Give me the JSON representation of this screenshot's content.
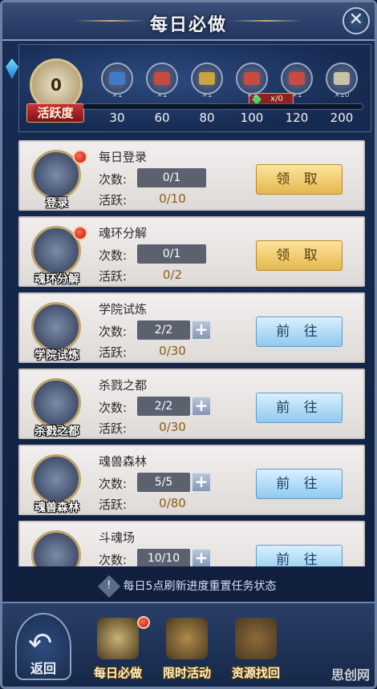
{
  "header": {
    "title": "每日必做",
    "close_icon": "close-icon"
  },
  "activity": {
    "current": "0",
    "label": "活跃度",
    "bonus_tag": "x/0",
    "progress_fraction": 0,
    "milestones": [
      {
        "value": "30",
        "qty": "×1",
        "color": "#3f7bc9"
      },
      {
        "value": "60",
        "qty": "×1",
        "color": "#c94b3f"
      },
      {
        "value": "80",
        "qty": "×1",
        "color": "#c9a43f"
      },
      {
        "value": "100",
        "qty": "×1",
        "color": "#c94b3f"
      },
      {
        "value": "120",
        "qty": "×1",
        "color": "#c94b3f"
      },
      {
        "value": "200",
        "qty": "×10",
        "color": "#c9c2a8"
      }
    ]
  },
  "tasks": [
    {
      "name": "每日登录",
      "icon_label": "登录",
      "count_label": "次数:",
      "count": "0/1",
      "active_label": "活跃:",
      "active": "0/10",
      "button": "领 取",
      "button_type": "claim",
      "has_plus": false,
      "has_dot": true,
      "icon": "scroll-icon"
    },
    {
      "name": "魂环分解",
      "icon_label": "魂环分解",
      "count_label": "次数:",
      "count": "0/1",
      "active_label": "活跃:",
      "active": "0/2",
      "button": "领 取",
      "button_type": "claim",
      "has_plus": false,
      "has_dot": true,
      "icon": "soul-ring-icon"
    },
    {
      "name": "学院试炼",
      "icon_label": "学院试炼",
      "count_label": "次数:",
      "count": "2/2",
      "active_label": "活跃:",
      "active": "0/30",
      "button": "前 往",
      "button_type": "go",
      "has_plus": true,
      "has_dot": false,
      "icon": "academy-icon"
    },
    {
      "name": "杀戮之都",
      "icon_label": "杀戮之都",
      "count_label": "次数:",
      "count": "2/2",
      "active_label": "活跃:",
      "active": "0/30",
      "button": "前 往",
      "button_type": "go",
      "has_plus": true,
      "has_dot": false,
      "icon": "goblet-icon"
    },
    {
      "name": "魂兽森林",
      "icon_label": "魂兽森林",
      "count_label": "次数:",
      "count": "5/5",
      "active_label": "活跃:",
      "active": "0/80",
      "button": "前 往",
      "button_type": "go",
      "has_plus": true,
      "has_dot": false,
      "icon": "beast-icon"
    },
    {
      "name": "斗魂场",
      "icon_label": "",
      "count_label": "次数:",
      "count": "10/10",
      "active_label": "活跃:",
      "active": "",
      "button": "前 往",
      "button_type": "go",
      "has_plus": true,
      "has_dot": false,
      "icon": "arena-icon"
    }
  ],
  "hint": {
    "icon": "exclamation-icon",
    "text": "每日5点刷新进度重置任务状态"
  },
  "bottom_nav": {
    "back_label": "返回",
    "tabs": [
      {
        "label": "每日必做",
        "icon": "quill-book-icon",
        "dot": true
      },
      {
        "label": "限时活动",
        "icon": "clock-book-icon",
        "dot": false
      },
      {
        "label": "资源找回",
        "icon": "treasure-chest-icon",
        "dot": false
      }
    ]
  },
  "watermark": "思创网"
}
